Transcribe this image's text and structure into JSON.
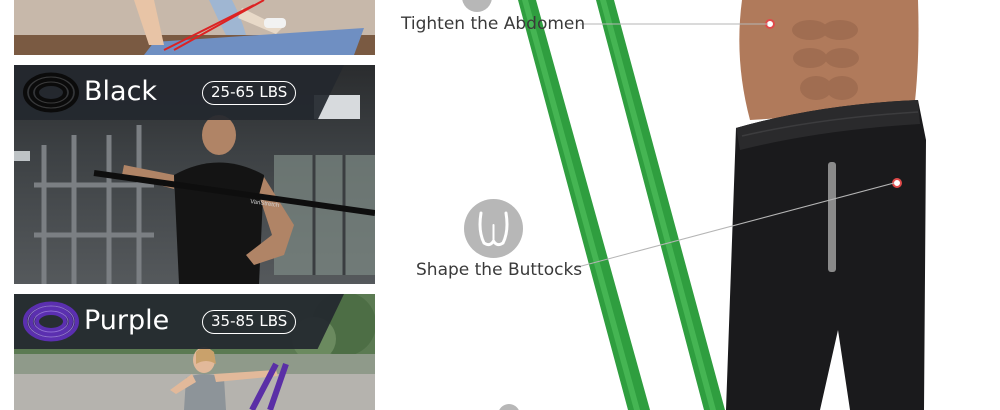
{
  "bands": [
    {
      "name": "Black",
      "resistance": "25-65 LBS",
      "color": "#1b1b1b"
    },
    {
      "name": "Purple",
      "resistance": "35-85 LBS",
      "color": "#6a3fb5"
    }
  ],
  "black_scene": {
    "band_brand": "VariStretch"
  },
  "callouts": [
    {
      "text": "Tighten the Abdomen",
      "icon": "abdomen-icon"
    },
    {
      "text": "Shape the Buttocks",
      "icon": "buttocks-icon"
    }
  ],
  "colors": {
    "label_bar": "#23282e",
    "green_band": "#2f9e3f",
    "marker": "#e04a4a",
    "icon_circle": "#b7b7b7"
  }
}
